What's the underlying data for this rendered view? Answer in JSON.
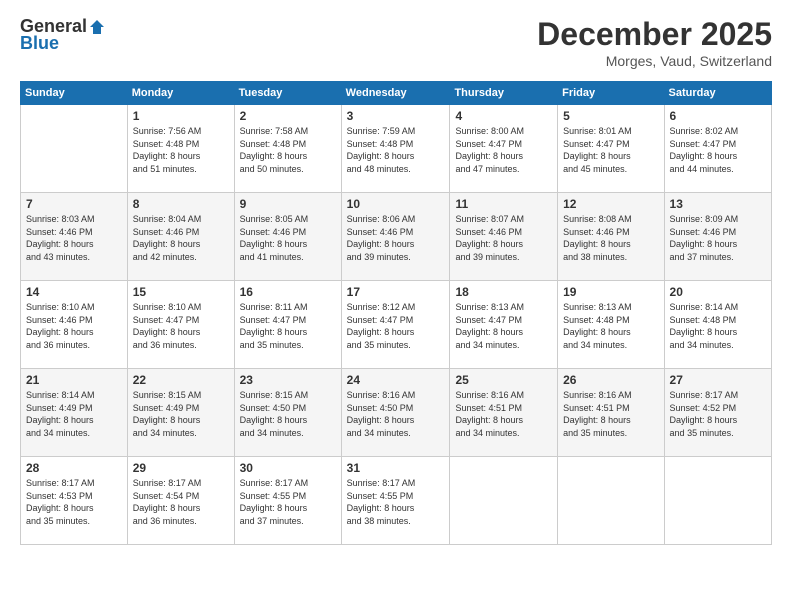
{
  "logo": {
    "general": "General",
    "blue": "Blue"
  },
  "title": {
    "month": "December 2025",
    "location": "Morges, Vaud, Switzerland"
  },
  "headers": [
    "Sunday",
    "Monday",
    "Tuesday",
    "Wednesday",
    "Thursday",
    "Friday",
    "Saturday"
  ],
  "weeks": [
    [
      {
        "day": "",
        "lines": []
      },
      {
        "day": "1",
        "lines": [
          "Sunrise: 7:56 AM",
          "Sunset: 4:48 PM",
          "Daylight: 8 hours",
          "and 51 minutes."
        ]
      },
      {
        "day": "2",
        "lines": [
          "Sunrise: 7:58 AM",
          "Sunset: 4:48 PM",
          "Daylight: 8 hours",
          "and 50 minutes."
        ]
      },
      {
        "day": "3",
        "lines": [
          "Sunrise: 7:59 AM",
          "Sunset: 4:48 PM",
          "Daylight: 8 hours",
          "and 48 minutes."
        ]
      },
      {
        "day": "4",
        "lines": [
          "Sunrise: 8:00 AM",
          "Sunset: 4:47 PM",
          "Daylight: 8 hours",
          "and 47 minutes."
        ]
      },
      {
        "day": "5",
        "lines": [
          "Sunrise: 8:01 AM",
          "Sunset: 4:47 PM",
          "Daylight: 8 hours",
          "and 45 minutes."
        ]
      },
      {
        "day": "6",
        "lines": [
          "Sunrise: 8:02 AM",
          "Sunset: 4:47 PM",
          "Daylight: 8 hours",
          "and 44 minutes."
        ]
      }
    ],
    [
      {
        "day": "7",
        "lines": [
          "Sunrise: 8:03 AM",
          "Sunset: 4:46 PM",
          "Daylight: 8 hours",
          "and 43 minutes."
        ]
      },
      {
        "day": "8",
        "lines": [
          "Sunrise: 8:04 AM",
          "Sunset: 4:46 PM",
          "Daylight: 8 hours",
          "and 42 minutes."
        ]
      },
      {
        "day": "9",
        "lines": [
          "Sunrise: 8:05 AM",
          "Sunset: 4:46 PM",
          "Daylight: 8 hours",
          "and 41 minutes."
        ]
      },
      {
        "day": "10",
        "lines": [
          "Sunrise: 8:06 AM",
          "Sunset: 4:46 PM",
          "Daylight: 8 hours",
          "and 39 minutes."
        ]
      },
      {
        "day": "11",
        "lines": [
          "Sunrise: 8:07 AM",
          "Sunset: 4:46 PM",
          "Daylight: 8 hours",
          "and 39 minutes."
        ]
      },
      {
        "day": "12",
        "lines": [
          "Sunrise: 8:08 AM",
          "Sunset: 4:46 PM",
          "Daylight: 8 hours",
          "and 38 minutes."
        ]
      },
      {
        "day": "13",
        "lines": [
          "Sunrise: 8:09 AM",
          "Sunset: 4:46 PM",
          "Daylight: 8 hours",
          "and 37 minutes."
        ]
      }
    ],
    [
      {
        "day": "14",
        "lines": [
          "Sunrise: 8:10 AM",
          "Sunset: 4:46 PM",
          "Daylight: 8 hours",
          "and 36 minutes."
        ]
      },
      {
        "day": "15",
        "lines": [
          "Sunrise: 8:10 AM",
          "Sunset: 4:47 PM",
          "Daylight: 8 hours",
          "and 36 minutes."
        ]
      },
      {
        "day": "16",
        "lines": [
          "Sunrise: 8:11 AM",
          "Sunset: 4:47 PM",
          "Daylight: 8 hours",
          "and 35 minutes."
        ]
      },
      {
        "day": "17",
        "lines": [
          "Sunrise: 8:12 AM",
          "Sunset: 4:47 PM",
          "Daylight: 8 hours",
          "and 35 minutes."
        ]
      },
      {
        "day": "18",
        "lines": [
          "Sunrise: 8:13 AM",
          "Sunset: 4:47 PM",
          "Daylight: 8 hours",
          "and 34 minutes."
        ]
      },
      {
        "day": "19",
        "lines": [
          "Sunrise: 8:13 AM",
          "Sunset: 4:48 PM",
          "Daylight: 8 hours",
          "and 34 minutes."
        ]
      },
      {
        "day": "20",
        "lines": [
          "Sunrise: 8:14 AM",
          "Sunset: 4:48 PM",
          "Daylight: 8 hours",
          "and 34 minutes."
        ]
      }
    ],
    [
      {
        "day": "21",
        "lines": [
          "Sunrise: 8:14 AM",
          "Sunset: 4:49 PM",
          "Daylight: 8 hours",
          "and 34 minutes."
        ]
      },
      {
        "day": "22",
        "lines": [
          "Sunrise: 8:15 AM",
          "Sunset: 4:49 PM",
          "Daylight: 8 hours",
          "and 34 minutes."
        ]
      },
      {
        "day": "23",
        "lines": [
          "Sunrise: 8:15 AM",
          "Sunset: 4:50 PM",
          "Daylight: 8 hours",
          "and 34 minutes."
        ]
      },
      {
        "day": "24",
        "lines": [
          "Sunrise: 8:16 AM",
          "Sunset: 4:50 PM",
          "Daylight: 8 hours",
          "and 34 minutes."
        ]
      },
      {
        "day": "25",
        "lines": [
          "Sunrise: 8:16 AM",
          "Sunset: 4:51 PM",
          "Daylight: 8 hours",
          "and 34 minutes."
        ]
      },
      {
        "day": "26",
        "lines": [
          "Sunrise: 8:16 AM",
          "Sunset: 4:51 PM",
          "Daylight: 8 hours",
          "and 35 minutes."
        ]
      },
      {
        "day": "27",
        "lines": [
          "Sunrise: 8:17 AM",
          "Sunset: 4:52 PM",
          "Daylight: 8 hours",
          "and 35 minutes."
        ]
      }
    ],
    [
      {
        "day": "28",
        "lines": [
          "Sunrise: 8:17 AM",
          "Sunset: 4:53 PM",
          "Daylight: 8 hours",
          "and 35 minutes."
        ]
      },
      {
        "day": "29",
        "lines": [
          "Sunrise: 8:17 AM",
          "Sunset: 4:54 PM",
          "Daylight: 8 hours",
          "and 36 minutes."
        ]
      },
      {
        "day": "30",
        "lines": [
          "Sunrise: 8:17 AM",
          "Sunset: 4:55 PM",
          "Daylight: 8 hours",
          "and 37 minutes."
        ]
      },
      {
        "day": "31",
        "lines": [
          "Sunrise: 8:17 AM",
          "Sunset: 4:55 PM",
          "Daylight: 8 hours",
          "and 38 minutes."
        ]
      },
      {
        "day": "",
        "lines": []
      },
      {
        "day": "",
        "lines": []
      },
      {
        "day": "",
        "lines": []
      }
    ]
  ]
}
